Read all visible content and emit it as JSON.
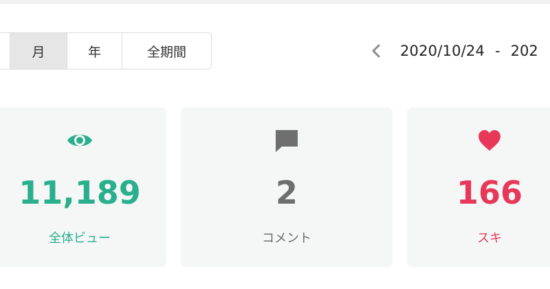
{
  "period_tabs": [
    {
      "label": "",
      "selected": false
    },
    {
      "label": "月",
      "selected": true
    },
    {
      "label": "年",
      "selected": false
    },
    {
      "label": "全期間",
      "selected": false
    }
  ],
  "date_range": {
    "start": "2020/10/24",
    "separator": "-",
    "end_partial": "202"
  },
  "stats": [
    {
      "icon": "eye-icon",
      "value": "11,189",
      "label": "全体ビュー",
      "color": "#2aaf8c"
    },
    {
      "icon": "comment-icon",
      "value": "2",
      "label": "コメント",
      "color": "#6e6e6e"
    },
    {
      "icon": "heart-icon",
      "value": "166",
      "label": "スキ",
      "color": "#e8385a"
    }
  ],
  "colors": {
    "accent_green": "#2aaf8c",
    "accent_red": "#e8385a",
    "neutral": "#6e6e6e",
    "card_bg": "#f5f7f7",
    "selected_tab_bg": "#e6e6e6"
  }
}
